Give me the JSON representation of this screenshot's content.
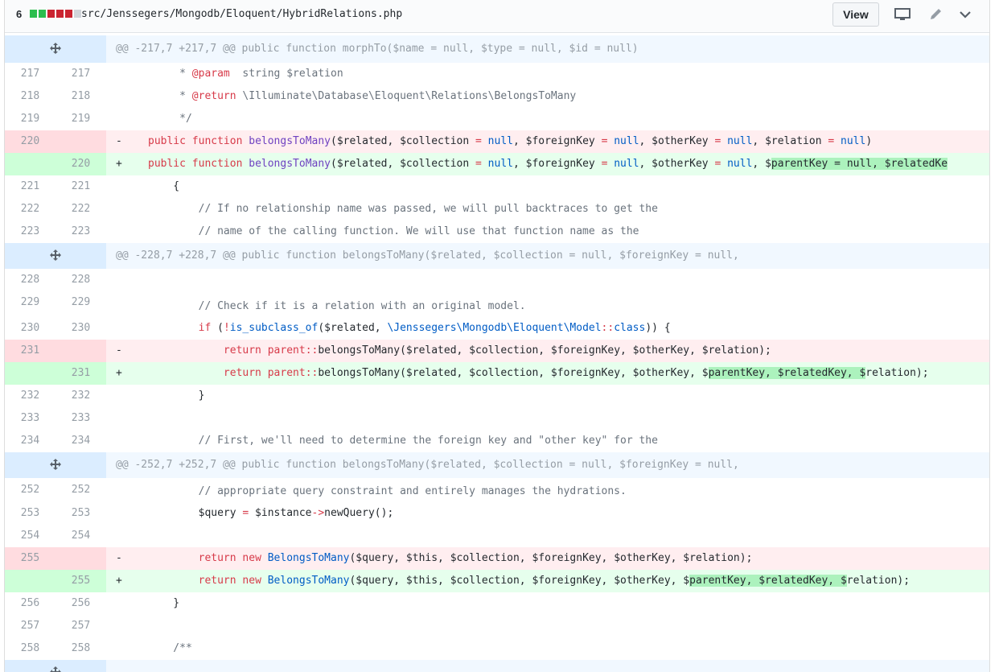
{
  "file_header": {
    "change_count": "6",
    "diffstat": [
      "#2cbe4e",
      "#2cbe4e",
      "#cb2431",
      "#cb2431",
      "#cb2431",
      "#d1d5da"
    ],
    "path": "src/Jenssegers/Mongodb/Eloquent/HybridRelations.php",
    "view_label": "View",
    "icons": [
      "desktop-icon",
      "pencil-icon",
      "chevron-down-icon"
    ]
  },
  "hunks": {
    "h1": "@@ -217,7 +217,7 @@ public function morphTo($name = null, $type = null, $id = null)",
    "h2": "@@ -228,7 +228,7 @@ public function belongsToMany($related, $collection = null, $foreignKey = null,",
    "h3": "@@ -252,7 +252,7 @@ public function belongsToMany($related, $collection = null, $foreignKey = null,"
  },
  "lines": {
    "l217": {
      "old": "217",
      "new": "217"
    },
    "l218": {
      "old": "218",
      "new": "218"
    },
    "l219": {
      "old": "219",
      "new": "219"
    },
    "l220d": {
      "old": "220",
      "new": "",
      "marker": "-"
    },
    "l220a": {
      "old": "",
      "new": "220",
      "marker": "+"
    },
    "l221": {
      "old": "221",
      "new": "221"
    },
    "l222": {
      "old": "222",
      "new": "222"
    },
    "l223": {
      "old": "223",
      "new": "223"
    },
    "l228": {
      "old": "228",
      "new": "228"
    },
    "l229": {
      "old": "229",
      "new": "229"
    },
    "l230": {
      "old": "230",
      "new": "230"
    },
    "l231d": {
      "old": "231",
      "new": "",
      "marker": "-"
    },
    "l231a": {
      "old": "",
      "new": "231",
      "marker": "+"
    },
    "l232": {
      "old": "232",
      "new": "232"
    },
    "l233": {
      "old": "233",
      "new": "233"
    },
    "l234": {
      "old": "234",
      "new": "234"
    },
    "l252": {
      "old": "252",
      "new": "252"
    },
    "l253": {
      "old": "253",
      "new": "253"
    },
    "l254": {
      "old": "254",
      "new": "254"
    },
    "l255d": {
      "old": "255",
      "new": "",
      "marker": "-"
    },
    "l255a": {
      "old": "",
      "new": "255",
      "marker": "+"
    },
    "l256": {
      "old": "256",
      "new": "256"
    },
    "l257": {
      "old": "257",
      "new": "257"
    },
    "l258": {
      "old": "258",
      "new": "258"
    }
  },
  "code": {
    "c217": [
      "     * ",
      "@param",
      "  string $relation"
    ],
    "c218": [
      "     * ",
      "@return",
      " \\Illuminate\\Database\\Eloquent\\Relations\\BelongsToMany"
    ],
    "c219": "     */",
    "c220d": [
      "public",
      "function",
      "belongsToMany",
      "($related, $collection ",
      "=",
      "null",
      ", $foreignKey ",
      "=",
      "null",
      ", $otherKey ",
      "=",
      "null",
      ", $relation ",
      "=",
      "null",
      ")"
    ],
    "c220a": [
      "public",
      "function",
      "belongsToMany",
      "($related, $collection ",
      "=",
      "null",
      ", $foreignKey ",
      "=",
      "null",
      ", $otherKey ",
      "=",
      "null",
      ", $",
      "parentKey = null, $relatedKe"
    ],
    "c221": "    {",
    "c222": "        // If no relationship name was passed, we will pull backtraces to get the",
    "c223": "        // name of the calling function. We will use that function name as the",
    "c228": "",
    "c229": "        // Check if it is a relation with an original model.",
    "c230": [
      "        ",
      "if",
      " (",
      "!",
      "is_subclass_of",
      "($related, ",
      "\\Jenssegers\\Mongodb\\Eloquent\\Model",
      "::",
      "class",
      ")) {"
    ],
    "c231d": [
      "return",
      "parent",
      "::",
      "belongsToMany($related, $collection, $foreignKey, $otherKey, $relation);"
    ],
    "c231a": [
      "return",
      "parent",
      "::",
      "belongsToMany($related, $collection, $foreignKey, $otherKey, $",
      "parentKey, $relatedKey, $",
      "relation);"
    ],
    "c232": "        }",
    "c233": "",
    "c234": "        // First, we'll need to determine the foreign key and \"other key\" for the",
    "c252": "        // appropriate query constraint and entirely manages the hydrations.",
    "c253": [
      "        $query ",
      "=",
      " $instance",
      "->",
      "newQuery();"
    ],
    "c254": "",
    "c255d": [
      "return",
      "new",
      "BelongsToMany",
      "($query, $this, $collection, $foreignKey, $otherKey, $relation);"
    ],
    "c255a": [
      "return",
      "new",
      "BelongsToMany",
      "($query, $this, $collection, $foreignKey, $otherKey, $",
      "parentKey, $relatedKey, $",
      "relation);"
    ],
    "c256": "    }",
    "c257": "",
    "c258": "    /**"
  }
}
